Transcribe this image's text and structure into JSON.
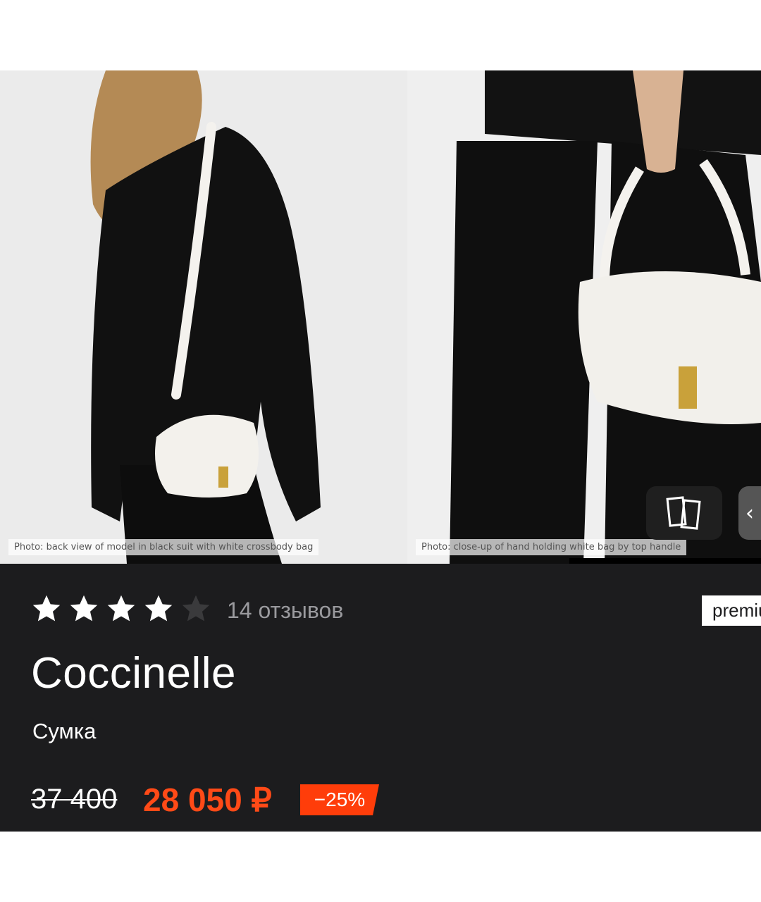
{
  "gallery": {
    "photos": [
      {
        "label": "Photo: back view of model in black suit with white crossbody bag"
      },
      {
        "label": "Photo: close-up of hand holding white bag by top handle"
      }
    ],
    "compare_icon": "compare-pages-icon",
    "next_icon": "chevron-left-icon",
    "next_glyph": "‹"
  },
  "product": {
    "rating": 4,
    "rating_max": 5,
    "reviews": "14 отзывов",
    "badge": "premium",
    "brand": "Coccinelle",
    "category": "Сумка",
    "old_price": "37 400",
    "new_price": "28 050 ₽",
    "discount": "−25%"
  },
  "colors": {
    "background": "#1c1c1e",
    "accent": "#ff4a17",
    "star_on": "#ffffff",
    "star_off": "#3a3a3c"
  }
}
